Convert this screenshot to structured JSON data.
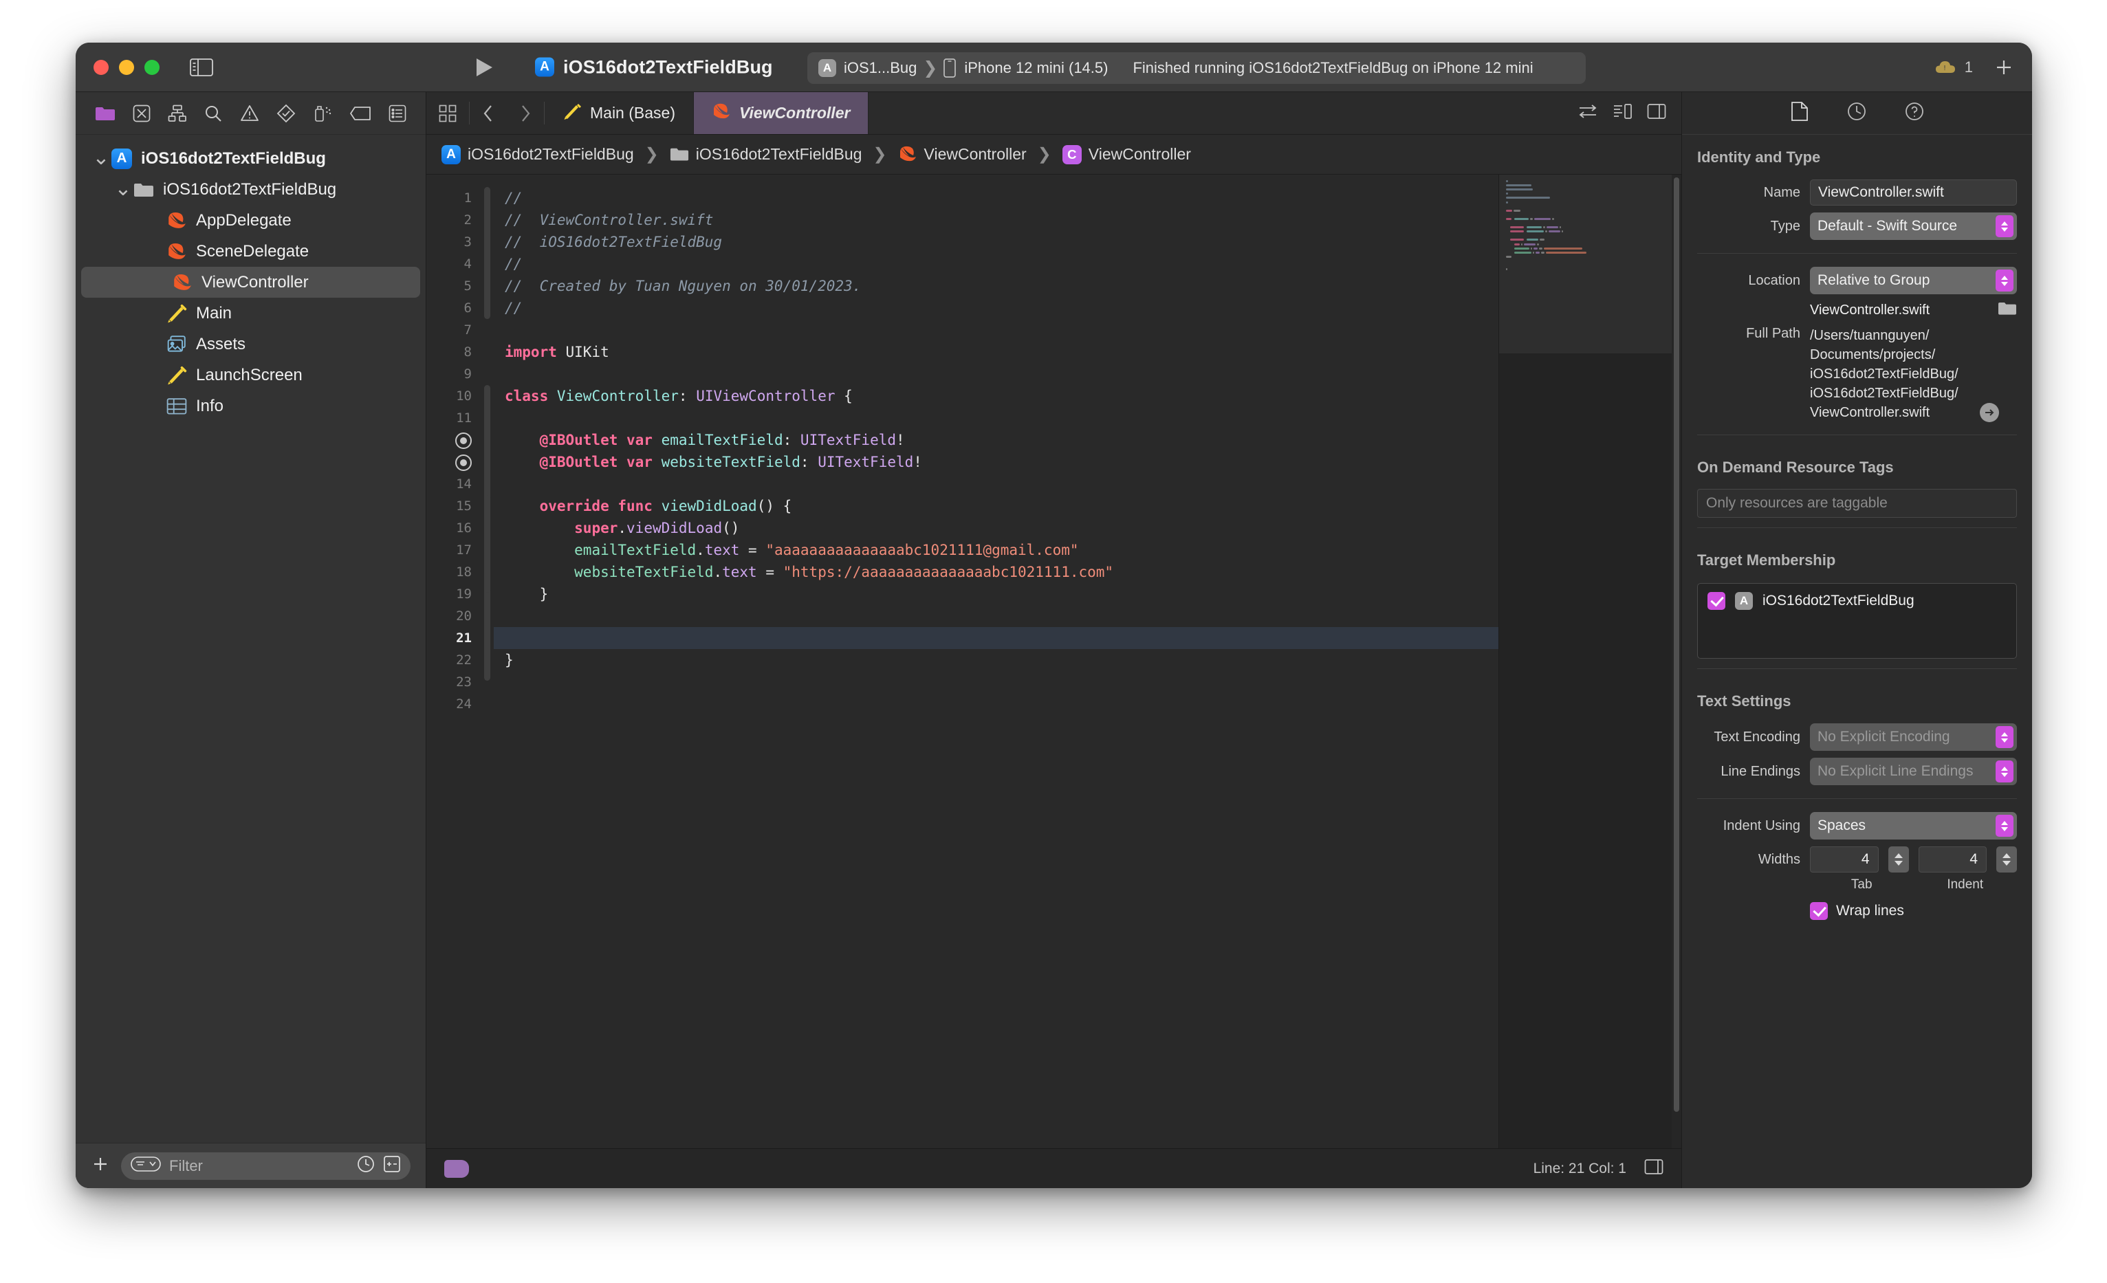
{
  "window": {
    "traffic_lights": [
      "close",
      "minimize",
      "zoom"
    ],
    "project_title": "iOS16dot2TextFieldBug"
  },
  "toolbar": {
    "sidebar_toggle_icon": "sidebar-left-icon",
    "run_icon": "play-icon",
    "scheme_name": "iOS1...Bug",
    "scheme_icon": "app-store-icon",
    "device_icon": "iphone-icon",
    "device_name": "iPhone 12 mini (14.5)",
    "status_message": "Finished running iOS16dot2TextFieldBug on iPhone 12 mini",
    "warning_icon": "cloud-warning-icon",
    "warning_count": "1",
    "add_icon": "plus-icon",
    "inspector_toggle_icon": "sidebar-right-icon"
  },
  "navigator": {
    "toolbar_icons": [
      "folder-icon",
      "source-control-icon",
      "symbol-hierarchy-icon",
      "search-icon",
      "warning-triangle-icon",
      "test-diamond-icon",
      "debug-spray-icon",
      "breakpoint-tag-icon",
      "report-list-icon"
    ],
    "tree": [
      {
        "label": "iOS16dot2TextFieldBug",
        "icon": "app-project-icon",
        "depth": 0,
        "twisty": "down",
        "selected": false
      },
      {
        "label": "iOS16dot2TextFieldBug",
        "icon": "folder-icon",
        "depth": 1,
        "twisty": "down",
        "selected": false
      },
      {
        "label": "AppDelegate",
        "icon": "swift-icon",
        "depth": 2,
        "twisty": "",
        "selected": false
      },
      {
        "label": "SceneDelegate",
        "icon": "swift-icon",
        "depth": 2,
        "twisty": "",
        "selected": false
      },
      {
        "label": "ViewController",
        "icon": "swift-icon",
        "depth": 2,
        "twisty": "",
        "selected": true
      },
      {
        "label": "Main",
        "icon": "storyboard-icon",
        "depth": 2,
        "twisty": "",
        "selected": false
      },
      {
        "label": "Assets",
        "icon": "assets-icon",
        "depth": 2,
        "twisty": "",
        "selected": false
      },
      {
        "label": "LaunchScreen",
        "icon": "storyboard-icon",
        "depth": 2,
        "twisty": "",
        "selected": false
      },
      {
        "label": "Info",
        "icon": "plist-icon",
        "depth": 2,
        "twisty": "",
        "selected": false
      }
    ],
    "add_button_icon": "plus-icon",
    "filter_placeholder": "Filter",
    "filter_value": "",
    "filter_menu_icon": "filter-lines-icon",
    "recent_icon": "clock-icon",
    "source-control_icon": "plusminus-box-icon"
  },
  "editor": {
    "tab_nav": {
      "grid_icon": "grid-icon",
      "back_icon": "chevron-left-icon",
      "forward_icon": "chevron-right-icon"
    },
    "tabs": [
      {
        "label": "Main (Base)",
        "icon": "storyboard-icon",
        "active": false
      },
      {
        "label": "ViewController",
        "icon": "swift-icon",
        "active": true
      }
    ],
    "right_icons": [
      "adjust-editor-icon",
      "code-review-icon",
      "add-editor-icon"
    ],
    "breadcrumb": [
      {
        "label": "iOS16dot2TextFieldBug",
        "icon": "app-project-icon"
      },
      {
        "label": "iOS16dot2TextFieldBug",
        "icon": "folder-icon"
      },
      {
        "label": "ViewController",
        "icon": "swift-icon"
      },
      {
        "label": "ViewController",
        "icon": "class-badge-icon"
      }
    ],
    "current_line_number": 21,
    "line_numbers": [
      "1",
      "2",
      "3",
      "4",
      "5",
      "6",
      "7",
      "8",
      "9",
      "10",
      "11",
      "◉",
      "◉",
      "14",
      "15",
      "16",
      "17",
      "18",
      "19",
      "20",
      "21",
      "22",
      "23",
      "24"
    ],
    "code_lines": [
      {
        "n": 1,
        "tokens": [
          {
            "t": "//",
            "c": "cm"
          }
        ]
      },
      {
        "n": 2,
        "tokens": [
          {
            "t": "//  ViewController.swift",
            "c": "cm"
          }
        ]
      },
      {
        "n": 3,
        "tokens": [
          {
            "t": "//  iOS16dot2TextFieldBug",
            "c": "cm"
          }
        ]
      },
      {
        "n": 4,
        "tokens": [
          {
            "t": "//",
            "c": "cm"
          }
        ]
      },
      {
        "n": 5,
        "tokens": [
          {
            "t": "//  Created by Tuan Nguyen on 30/01/2023.",
            "c": "cm"
          }
        ]
      },
      {
        "n": 6,
        "tokens": [
          {
            "t": "//",
            "c": "cm"
          }
        ]
      },
      {
        "n": 7,
        "tokens": []
      },
      {
        "n": 8,
        "tokens": [
          {
            "t": "import",
            "c": "k"
          },
          {
            "t": " UIKit",
            "c": "pl"
          }
        ]
      },
      {
        "n": 9,
        "tokens": []
      },
      {
        "n": 10,
        "tokens": [
          {
            "t": "class",
            "c": "k"
          },
          {
            "t": " ",
            "c": "pl"
          },
          {
            "t": "ViewController",
            "c": "ty"
          },
          {
            "t": ": ",
            "c": "pl"
          },
          {
            "t": "UIViewController",
            "c": "sy"
          },
          {
            "t": " {",
            "c": "pl"
          }
        ]
      },
      {
        "n": 11,
        "tokens": []
      },
      {
        "n": 12,
        "tokens": [
          {
            "t": "    ",
            "c": "pl"
          },
          {
            "t": "@IBOutlet var",
            "c": "k"
          },
          {
            "t": " ",
            "c": "pl"
          },
          {
            "t": "emailTextField",
            "c": "ty"
          },
          {
            "t": ": ",
            "c": "pl"
          },
          {
            "t": "UITextField",
            "c": "sy"
          },
          {
            "t": "!",
            "c": "pl"
          }
        ]
      },
      {
        "n": 13,
        "tokens": [
          {
            "t": "    ",
            "c": "pl"
          },
          {
            "t": "@IBOutlet var",
            "c": "k"
          },
          {
            "t": " ",
            "c": "pl"
          },
          {
            "t": "websiteTextField",
            "c": "ty"
          },
          {
            "t": ": ",
            "c": "pl"
          },
          {
            "t": "UITextField",
            "c": "sy"
          },
          {
            "t": "!",
            "c": "pl"
          }
        ]
      },
      {
        "n": 14,
        "tokens": []
      },
      {
        "n": 15,
        "tokens": [
          {
            "t": "    ",
            "c": "pl"
          },
          {
            "t": "override func",
            "c": "k"
          },
          {
            "t": " ",
            "c": "pl"
          },
          {
            "t": "viewDidLoad",
            "c": "ty"
          },
          {
            "t": "() {",
            "c": "pl"
          }
        ]
      },
      {
        "n": 16,
        "tokens": [
          {
            "t": "        ",
            "c": "pl"
          },
          {
            "t": "super",
            "c": "k"
          },
          {
            "t": ".",
            "c": "pl"
          },
          {
            "t": "viewDidLoad",
            "c": "sy"
          },
          {
            "t": "()",
            "c": "pl"
          }
        ]
      },
      {
        "n": 17,
        "tokens": [
          {
            "t": "        ",
            "c": "pl"
          },
          {
            "t": "emailTextField",
            "c": "pr"
          },
          {
            "t": ".",
            "c": "pl"
          },
          {
            "t": "text",
            "c": "sy"
          },
          {
            "t": " = ",
            "c": "pl"
          },
          {
            "t": "\"aaaaaaaaaaaaaaabc1021111@gmail.com\"",
            "c": "st"
          }
        ]
      },
      {
        "n": 18,
        "tokens": [
          {
            "t": "        ",
            "c": "pl"
          },
          {
            "t": "websiteTextField",
            "c": "pr"
          },
          {
            "t": ".",
            "c": "pl"
          },
          {
            "t": "text",
            "c": "sy"
          },
          {
            "t": " = ",
            "c": "pl"
          },
          {
            "t": "\"https://aaaaaaaaaaaaaaabc1021111.com\"",
            "c": "st"
          }
        ]
      },
      {
        "n": 19,
        "tokens": [
          {
            "t": "    }",
            "c": "pl"
          }
        ]
      },
      {
        "n": 20,
        "tokens": []
      },
      {
        "n": 21,
        "tokens": []
      },
      {
        "n": 22,
        "tokens": [
          {
            "t": "}",
            "c": "pl"
          }
        ]
      },
      {
        "n": 23,
        "tokens": []
      },
      {
        "n": 24,
        "tokens": []
      }
    ]
  },
  "status_bar": {
    "build_lozenge_icon": "build-lozenge-icon",
    "line_col": "Line: 21  Col: 1",
    "minimap_toggle_icon": "minimap-toggle-icon"
  },
  "inspector": {
    "toolbar_icons": [
      "file-inspector-icon",
      "history-inspector-icon",
      "quick-help-icon"
    ],
    "identity_and_type": {
      "title": "Identity and Type",
      "name_label": "Name",
      "name_value": "ViewController.swift",
      "type_label": "Type",
      "type_value": "Default - Swift Source",
      "location_label": "Location",
      "location_value": "Relative to Group",
      "location_filename": "ViewController.swift",
      "folder_icon": "folder-icon",
      "full_path_label": "Full Path",
      "full_path_value": "/Users/tuannguyen/Documents/projects/iOS16dot2TextFieldBug/iOS16dot2TextFieldBug/ViewController.swift",
      "reveal_icon": "arrow-right-circle-icon"
    },
    "on_demand_resource_tags": {
      "title": "On Demand Resource Tags",
      "placeholder": "Only resources are taggable",
      "value": ""
    },
    "target_membership": {
      "title": "Target Membership",
      "targets": [
        {
          "name": "iOS16dot2TextFieldBug",
          "checked": true,
          "icon": "app-target-icon"
        }
      ]
    },
    "text_settings": {
      "title": "Text Settings",
      "text_encoding_label": "Text Encoding",
      "text_encoding_value": "No Explicit Encoding",
      "line_endings_label": "Line Endings",
      "line_endings_value": "No Explicit Line Endings",
      "indent_using_label": "Indent Using",
      "indent_using_value": "Spaces",
      "widths_label": "Widths",
      "tab_width": "4",
      "indent_width": "4",
      "tab_sublabel": "Tab",
      "indent_sublabel": "Indent",
      "wrap_lines_label": "Wrap lines",
      "wrap_lines_checked": true
    }
  },
  "colors": {
    "accent_magenta": "#cf4ee0",
    "tab_active": "#5d4f68",
    "swift_orange": "#f05a28",
    "storyboard_yellow": "#f5d33a",
    "keyword_pink": "#ff6f9b",
    "string_salmon": "#f08d7a"
  }
}
